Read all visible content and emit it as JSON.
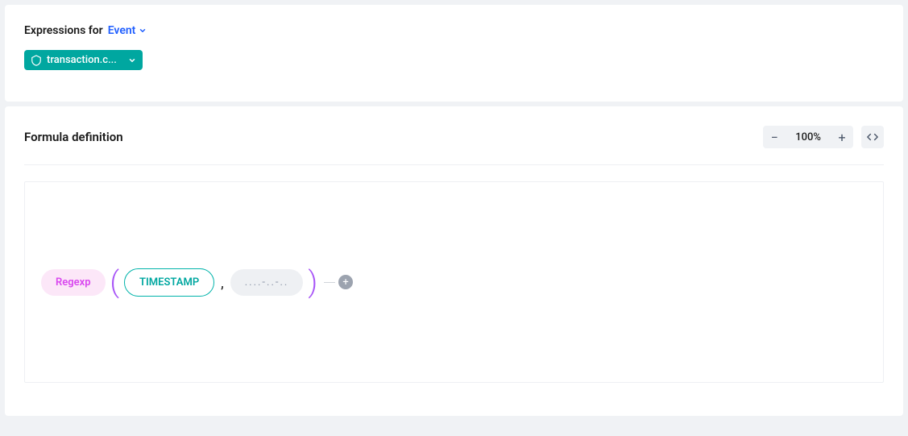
{
  "expressions": {
    "label": "Expressions for",
    "dropdown_label": "Event",
    "chip_text": "transaction.c..."
  },
  "formula": {
    "title": "Formula definition",
    "zoom": "100%",
    "function_name": "Regexp",
    "arg1": "TIMESTAMP",
    "arg2": "....-..-.."
  }
}
